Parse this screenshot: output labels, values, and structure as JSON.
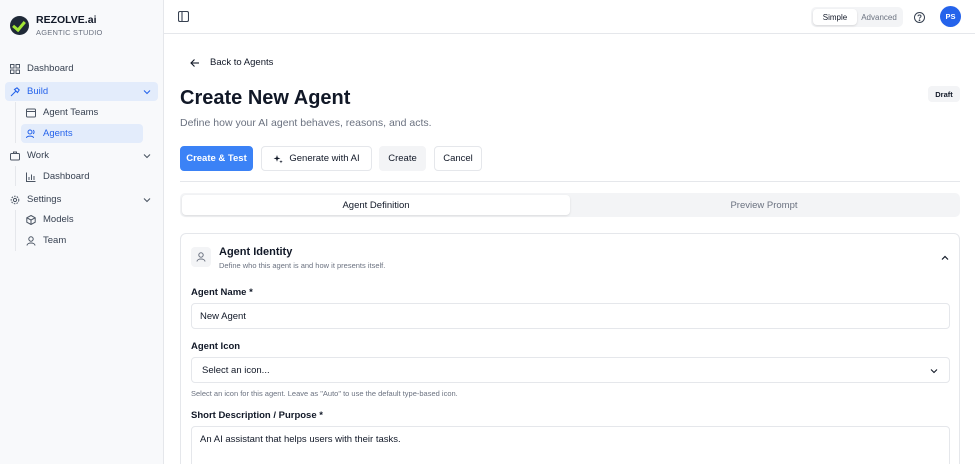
{
  "brand": {
    "name": "REZOLVE.ai",
    "subtitle": "AGENTIC STUDIO"
  },
  "sidebar": {
    "dashboard": "Dashboard",
    "build": {
      "label": "Build",
      "items": [
        "Agent Teams",
        "Agents"
      ]
    },
    "work": {
      "label": "Work",
      "items": [
        "Dashboard"
      ]
    },
    "settings": {
      "label": "Settings",
      "items": [
        "Models",
        "Team"
      ]
    }
  },
  "topbar": {
    "modes": [
      "Simple",
      "Advanced"
    ],
    "active_mode": "Simple",
    "avatar_initials": "PS"
  },
  "main": {
    "back_label": "Back to Agents",
    "title": "Create New Agent",
    "subtitle": "Define how your AI agent behaves, reasons, and acts.",
    "status_badge": "Draft",
    "actions": {
      "create_test": "Create & Test",
      "generate_ai": "Generate with AI",
      "create": "Create",
      "cancel": "Cancel"
    },
    "tabs": [
      "Agent Definition",
      "Preview Prompt"
    ],
    "active_tab": "Agent Definition"
  },
  "identity_card": {
    "title": "Agent Identity",
    "description": "Define who this agent is and how it presents itself.",
    "fields": {
      "name_label": "Agent Name *",
      "name_value": "New Agent",
      "icon_label": "Agent Icon",
      "icon_placeholder": "Select an icon...",
      "icon_hint": "Select an icon for this agent. Leave as \"Auto\" to use the default type-based icon.",
      "description_label": "Short Description / Purpose *",
      "description_value": "An AI assistant that helps users with their tasks."
    }
  },
  "colors": {
    "accent": "#3b82f6",
    "active_bg": "#e3ecfb",
    "active_text": "#2563eb"
  }
}
